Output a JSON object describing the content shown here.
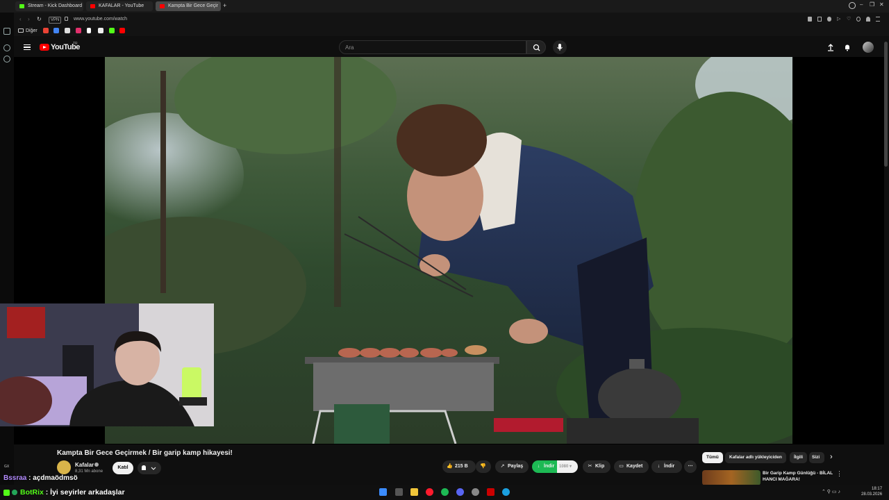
{
  "browser": {
    "tabs": [
      {
        "label": "Stream - Kick Dashboard",
        "color": "#53fc18"
      },
      {
        "label": "KAFALAR - YouTube",
        "color": "#ff0000"
      },
      {
        "label": "Kampta Bir Gece Geçir",
        "color": "#ff0000"
      }
    ],
    "new_tab_symbol": "+",
    "vpn_label": "VPN",
    "url": "www.youtube.com/watch",
    "bookmarks_folder": "Diğer",
    "window_controls": [
      "–",
      "❐",
      "✕"
    ]
  },
  "youtube": {
    "logo_text": "YouTube",
    "region": "TR",
    "search_placeholder": "Ara",
    "video": {
      "title": "Kampta Bir Gece Geçirmek / Bir garip kamp hikayesi!",
      "channel": "Kafalar",
      "subscribers": "8,31 Mn abone",
      "join_label": "Katıl",
      "likes": "215 B",
      "share_label": "Paylaş",
      "download_green_label": "İndir",
      "quality_label": "1080",
      "clip_label": "Klip",
      "save_label": "Kaydet",
      "download_label": "İndir",
      "more_symbol": "⋯"
    },
    "chips": [
      "Tümü",
      "Kafalar adlı yükleyiciden",
      "İlgili",
      "Sizi"
    ],
    "recommendation": {
      "title": "Bir Garip Kamp Günlüğü - BİLAL HANCI MAĞARA!"
    }
  },
  "chat": [
    {
      "user": "Bssraa",
      "message": " : açdmaödmsö"
    },
    {
      "user": "BotRix",
      "message": " : İyi seyirler arkadaşlar"
    }
  ],
  "overlay_gx": "GX",
  "taskbar": {
    "time": "18:17",
    "date": "28.03.2026"
  }
}
